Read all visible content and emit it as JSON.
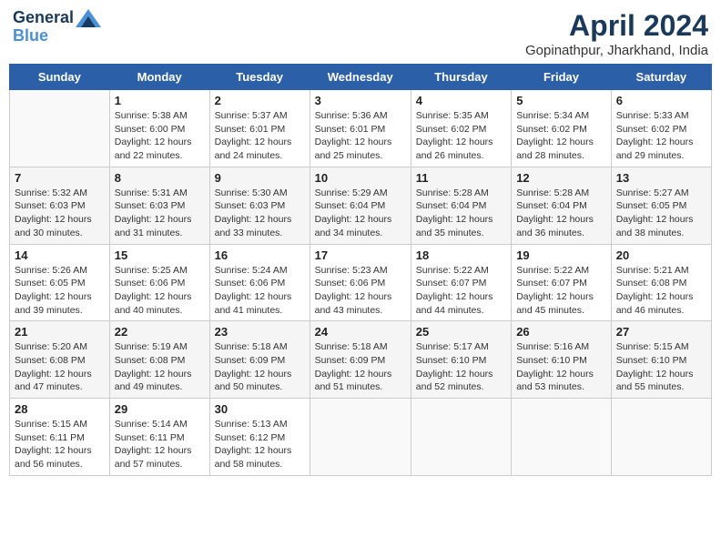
{
  "header": {
    "logo_line1": "General",
    "logo_line2": "Blue",
    "title": "April 2024",
    "subtitle": "Gopinathpur, Jharkhand, India"
  },
  "columns": [
    "Sunday",
    "Monday",
    "Tuesday",
    "Wednesday",
    "Thursday",
    "Friday",
    "Saturday"
  ],
  "weeks": [
    [
      {
        "day": "",
        "info": ""
      },
      {
        "day": "1",
        "info": "Sunrise: 5:38 AM\nSunset: 6:00 PM\nDaylight: 12 hours\nand 22 minutes."
      },
      {
        "day": "2",
        "info": "Sunrise: 5:37 AM\nSunset: 6:01 PM\nDaylight: 12 hours\nand 24 minutes."
      },
      {
        "day": "3",
        "info": "Sunrise: 5:36 AM\nSunset: 6:01 PM\nDaylight: 12 hours\nand 25 minutes."
      },
      {
        "day": "4",
        "info": "Sunrise: 5:35 AM\nSunset: 6:02 PM\nDaylight: 12 hours\nand 26 minutes."
      },
      {
        "day": "5",
        "info": "Sunrise: 5:34 AM\nSunset: 6:02 PM\nDaylight: 12 hours\nand 28 minutes."
      },
      {
        "day": "6",
        "info": "Sunrise: 5:33 AM\nSunset: 6:02 PM\nDaylight: 12 hours\nand 29 minutes."
      }
    ],
    [
      {
        "day": "7",
        "info": "Sunrise: 5:32 AM\nSunset: 6:03 PM\nDaylight: 12 hours\nand 30 minutes."
      },
      {
        "day": "8",
        "info": "Sunrise: 5:31 AM\nSunset: 6:03 PM\nDaylight: 12 hours\nand 31 minutes."
      },
      {
        "day": "9",
        "info": "Sunrise: 5:30 AM\nSunset: 6:03 PM\nDaylight: 12 hours\nand 33 minutes."
      },
      {
        "day": "10",
        "info": "Sunrise: 5:29 AM\nSunset: 6:04 PM\nDaylight: 12 hours\nand 34 minutes."
      },
      {
        "day": "11",
        "info": "Sunrise: 5:28 AM\nSunset: 6:04 PM\nDaylight: 12 hours\nand 35 minutes."
      },
      {
        "day": "12",
        "info": "Sunrise: 5:28 AM\nSunset: 6:04 PM\nDaylight: 12 hours\nand 36 minutes."
      },
      {
        "day": "13",
        "info": "Sunrise: 5:27 AM\nSunset: 6:05 PM\nDaylight: 12 hours\nand 38 minutes."
      }
    ],
    [
      {
        "day": "14",
        "info": "Sunrise: 5:26 AM\nSunset: 6:05 PM\nDaylight: 12 hours\nand 39 minutes."
      },
      {
        "day": "15",
        "info": "Sunrise: 5:25 AM\nSunset: 6:06 PM\nDaylight: 12 hours\nand 40 minutes."
      },
      {
        "day": "16",
        "info": "Sunrise: 5:24 AM\nSunset: 6:06 PM\nDaylight: 12 hours\nand 41 minutes."
      },
      {
        "day": "17",
        "info": "Sunrise: 5:23 AM\nSunset: 6:06 PM\nDaylight: 12 hours\nand 43 minutes."
      },
      {
        "day": "18",
        "info": "Sunrise: 5:22 AM\nSunset: 6:07 PM\nDaylight: 12 hours\nand 44 minutes."
      },
      {
        "day": "19",
        "info": "Sunrise: 5:22 AM\nSunset: 6:07 PM\nDaylight: 12 hours\nand 45 minutes."
      },
      {
        "day": "20",
        "info": "Sunrise: 5:21 AM\nSunset: 6:08 PM\nDaylight: 12 hours\nand 46 minutes."
      }
    ],
    [
      {
        "day": "21",
        "info": "Sunrise: 5:20 AM\nSunset: 6:08 PM\nDaylight: 12 hours\nand 47 minutes."
      },
      {
        "day": "22",
        "info": "Sunrise: 5:19 AM\nSunset: 6:08 PM\nDaylight: 12 hours\nand 49 minutes."
      },
      {
        "day": "23",
        "info": "Sunrise: 5:18 AM\nSunset: 6:09 PM\nDaylight: 12 hours\nand 50 minutes."
      },
      {
        "day": "24",
        "info": "Sunrise: 5:18 AM\nSunset: 6:09 PM\nDaylight: 12 hours\nand 51 minutes."
      },
      {
        "day": "25",
        "info": "Sunrise: 5:17 AM\nSunset: 6:10 PM\nDaylight: 12 hours\nand 52 minutes."
      },
      {
        "day": "26",
        "info": "Sunrise: 5:16 AM\nSunset: 6:10 PM\nDaylight: 12 hours\nand 53 minutes."
      },
      {
        "day": "27",
        "info": "Sunrise: 5:15 AM\nSunset: 6:10 PM\nDaylight: 12 hours\nand 55 minutes."
      }
    ],
    [
      {
        "day": "28",
        "info": "Sunrise: 5:15 AM\nSunset: 6:11 PM\nDaylight: 12 hours\nand 56 minutes."
      },
      {
        "day": "29",
        "info": "Sunrise: 5:14 AM\nSunset: 6:11 PM\nDaylight: 12 hours\nand 57 minutes."
      },
      {
        "day": "30",
        "info": "Sunrise: 5:13 AM\nSunset: 6:12 PM\nDaylight: 12 hours\nand 58 minutes."
      },
      {
        "day": "",
        "info": ""
      },
      {
        "day": "",
        "info": ""
      },
      {
        "day": "",
        "info": ""
      },
      {
        "day": "",
        "info": ""
      }
    ]
  ]
}
